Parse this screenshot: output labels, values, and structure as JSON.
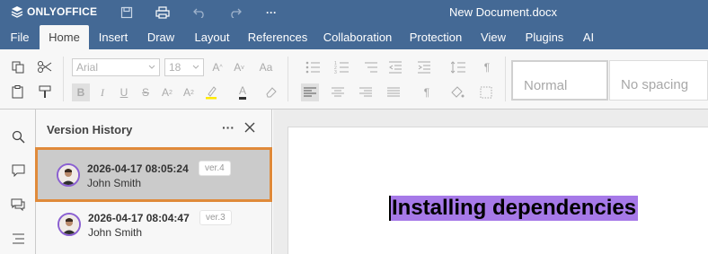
{
  "app": {
    "logo_text": "ONLYOFFICE",
    "document_title": "New Document.docx",
    "brand_color": "#446995"
  },
  "titlebar_icons": [
    "save-icon",
    "print-icon",
    "undo-icon",
    "redo-icon",
    "more-icon"
  ],
  "menu_tabs": [
    {
      "label": "File",
      "active": false
    },
    {
      "label": "Home",
      "active": true
    },
    {
      "label": "Insert",
      "active": false
    },
    {
      "label": "Draw",
      "active": false
    },
    {
      "label": "Layout",
      "active": false
    },
    {
      "label": "References",
      "active": false
    },
    {
      "label": "Collaboration",
      "active": false
    },
    {
      "label": "Protection",
      "active": false
    },
    {
      "label": "View",
      "active": false
    },
    {
      "label": "Plugins",
      "active": false
    },
    {
      "label": "AI",
      "active": false
    }
  ],
  "toolbar": {
    "font_name": "Arial",
    "font_size": "18",
    "styles": [
      {
        "label": "Normal"
      },
      {
        "label": "No spacing"
      }
    ]
  },
  "version_history": {
    "title": "Version History",
    "versions": [
      {
        "date": "2026-04-17 08:05:24",
        "badge": "ver.4",
        "user": "John Smith",
        "selected": true
      },
      {
        "date": "2026-04-17 08:04:47",
        "badge": "ver.3",
        "user": "John Smith",
        "selected": false
      }
    ],
    "selection_outline_color": "#e08a3a",
    "avatar_ring_color": "#8a5fd1"
  },
  "document": {
    "heading_text": "Installing dependencies",
    "highlight_color": "#a679e8"
  }
}
